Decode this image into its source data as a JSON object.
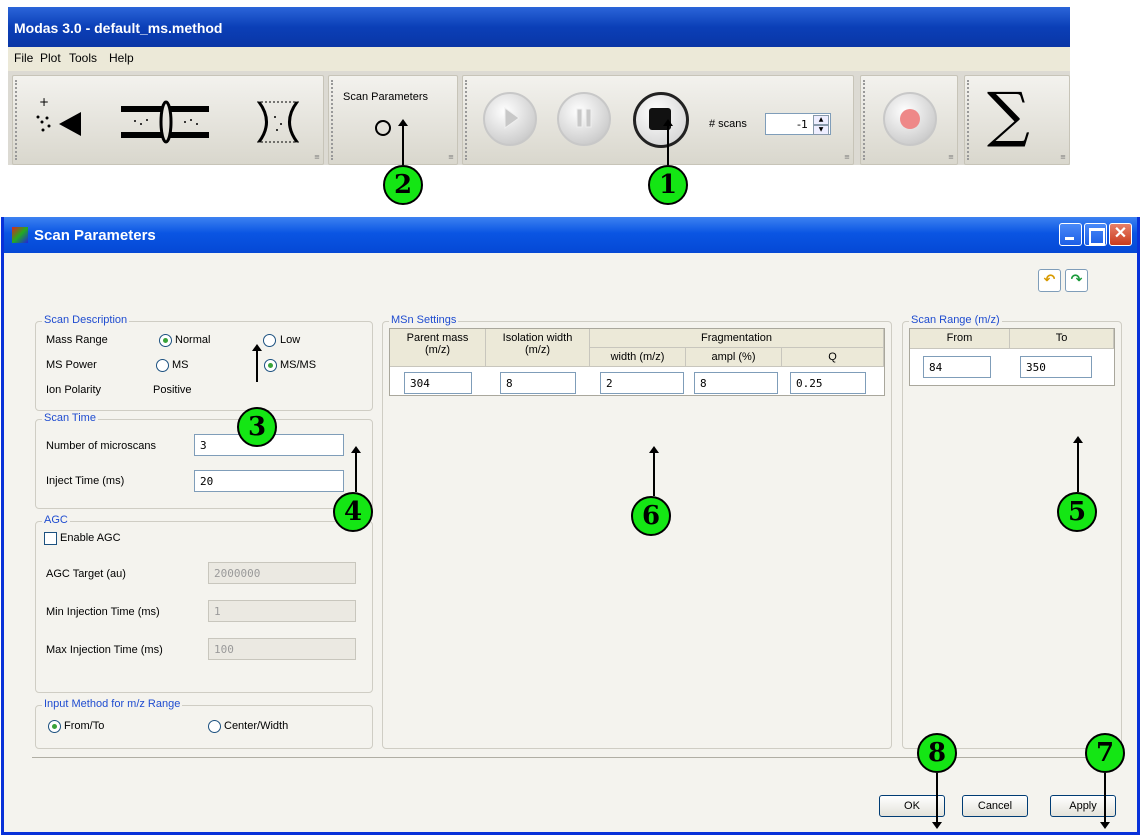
{
  "app": {
    "title": "Modas 3.0 - default_ms.method",
    "menu": [
      "File",
      "Plot",
      "Tools",
      "Help"
    ],
    "toolbar": {
      "scan_parameters_label": "Scan Parameters",
      "scans_label": "# scans",
      "scans_value": "-1"
    }
  },
  "dialog": {
    "title": "Scan Parameters",
    "scan_description": {
      "title": "Scan Description",
      "mass_range_label": "Mass Range",
      "mass_range_options": [
        "Normal",
        "Low"
      ],
      "mass_range_selected": "Normal",
      "ms_power_label": "MS Power",
      "ms_power_options": [
        "MS",
        "MS/MS"
      ],
      "ms_power_selected": "MS/MS",
      "ion_polarity_label": "Ion Polarity",
      "ion_polarity_value": "Positive"
    },
    "scan_time": {
      "title": "Scan Time",
      "microscans_label": "Number of microscans",
      "microscans_value": "3",
      "inject_time_label": "Inject Time (ms)",
      "inject_time_value": "20"
    },
    "agc": {
      "title": "AGC",
      "enable_label": "Enable AGC",
      "enabled": false,
      "target_label": "AGC Target (au)",
      "target_value": "2000000",
      "min_injection_label": "Min Injection Time (ms)",
      "min_injection_value": "1",
      "max_injection_label": "Max Injection Time (ms)",
      "max_injection_value": "100"
    },
    "input_method": {
      "title": "Input Method for m/z Range",
      "options": [
        "From/To",
        "Center/Width"
      ],
      "selected": "From/To"
    },
    "msn_settings": {
      "title": "MSn Settings",
      "headers": {
        "parent_mass": "Parent mass\n(m/z)",
        "isolation_width": "Isolation width\n(m/z)",
        "fragmentation": "Fragmentation",
        "width": "width (m/z)",
        "ampl": "ampl (%)",
        "q": "Q"
      },
      "row": [
        "304",
        "8",
        "2",
        "8",
        "0.25"
      ]
    },
    "scan_range": {
      "title": "Scan Range (m/z)",
      "headers": [
        "From",
        "To"
      ],
      "row": [
        "84",
        "350"
      ]
    },
    "buttons": {
      "ok": "OK",
      "cancel": "Cancel",
      "apply": "Apply"
    }
  },
  "callouts": [
    "1",
    "2",
    "3",
    "4",
    "5",
    "6",
    "7",
    "8"
  ],
  "colors": {
    "callout": "#14e614",
    "title_blue": "#0a55e3",
    "group_title": "#1f4cd0"
  }
}
